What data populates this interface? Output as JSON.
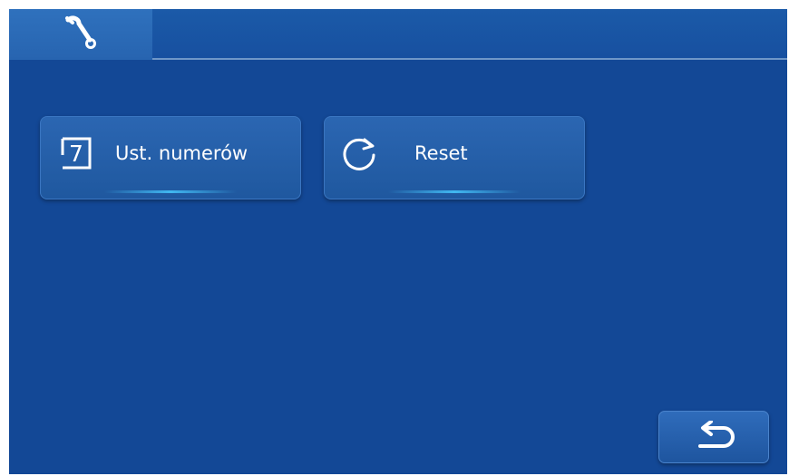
{
  "header": {
    "tabs": [
      {
        "icon": "wrench-icon",
        "active": true
      }
    ]
  },
  "tiles": [
    {
      "label": "Ust. numerów",
      "icon": "number-seven-icon",
      "icon_glyph": "7"
    },
    {
      "label": "Reset",
      "icon": "refresh-icon"
    }
  ],
  "footer": {
    "back_icon": "return-arrow-icon"
  },
  "colors": {
    "background": "#134896",
    "topbar": "#1b5aa8",
    "active_tab": "#2f71bd",
    "tile": "#2b66b2",
    "accent_glow": "#46c8ff",
    "text": "#ffffff"
  }
}
